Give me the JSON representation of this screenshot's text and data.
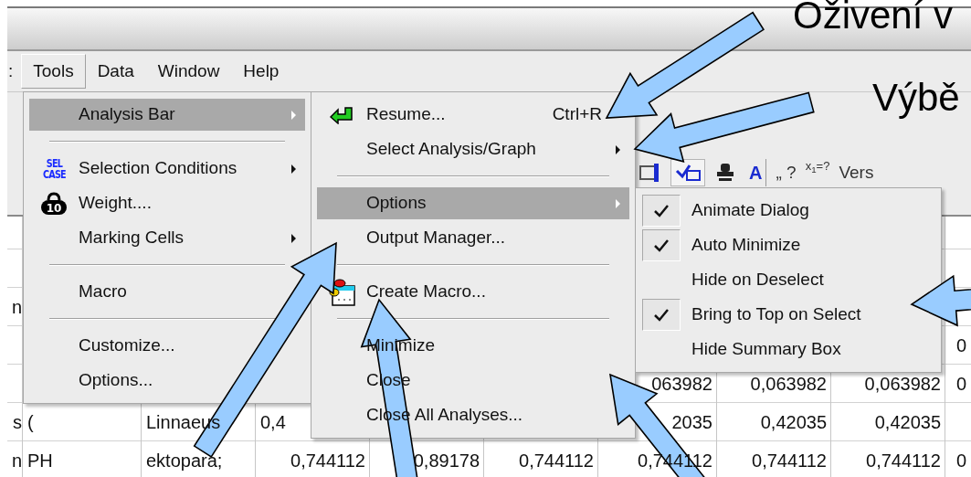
{
  "slide_captions": [
    "Oživení v",
    "Výbě"
  ],
  "menu_bar": [
    {
      "label": ":",
      "selected": false
    },
    {
      "label": "Tools",
      "selected": true
    },
    {
      "label": "Data",
      "selected": false
    },
    {
      "label": "Window",
      "selected": false
    },
    {
      "label": "Help",
      "selected": false
    }
  ],
  "toolbar": [
    {
      "kind": "frame-icon"
    },
    {
      "kind": "check-button"
    },
    {
      "kind": "stamp-icon"
    },
    {
      "kind": "font-button",
      "label": "A"
    },
    {
      "kind": "text",
      "label": "„ ?"
    },
    {
      "kind": "formula",
      "label": "x$_{1}$=?"
    },
    {
      "kind": "text",
      "label": "Vers"
    }
  ],
  "tools_menu": [
    {
      "kind": "item",
      "label": "Analysis Bar",
      "selected": true,
      "submenu": true
    },
    {
      "kind": "separator"
    },
    {
      "kind": "item",
      "label": "Selection Conditions",
      "selected": false,
      "submenu": true,
      "icon": {
        "kind": "sel-case",
        "lines": [
          "SEL",
          "CASE"
        ]
      }
    },
    {
      "kind": "item",
      "label": "Weight....",
      "selected": false,
      "submenu": false,
      "icon": {
        "kind": "weight",
        "text": "10"
      }
    },
    {
      "kind": "item",
      "label": "Marking Cells",
      "selected": false,
      "submenu": true
    },
    {
      "kind": "separator"
    },
    {
      "kind": "item",
      "label": "Macro",
      "selected": false,
      "submenu": false
    },
    {
      "kind": "separator"
    },
    {
      "kind": "item",
      "label": "Customize...",
      "selected": false,
      "submenu": false
    },
    {
      "kind": "item",
      "label": "Options...",
      "selected": false,
      "submenu": false
    }
  ],
  "analysis_bar_menu": [
    {
      "kind": "item",
      "label": "Resume...",
      "selected": false,
      "submenu": false,
      "shortcut": "Ctrl+R",
      "icon": {
        "kind": "resume"
      }
    },
    {
      "kind": "item",
      "label": "Select Analysis/Graph",
      "selected": false,
      "submenu": true
    },
    {
      "kind": "separator"
    },
    {
      "kind": "item",
      "label": "Options",
      "selected": true,
      "submenu": true
    },
    {
      "kind": "item",
      "label": "Output Manager...",
      "selected": false,
      "submenu": false
    },
    {
      "kind": "separator"
    },
    {
      "kind": "item",
      "label": "Create Macro...",
      "selected": false,
      "submenu": false,
      "icon": {
        "kind": "macro"
      }
    },
    {
      "kind": "separator"
    },
    {
      "kind": "item",
      "label": "Minimize",
      "selected": false,
      "submenu": false
    },
    {
      "kind": "item",
      "label": "Close",
      "selected": false,
      "submenu": false
    },
    {
      "kind": "item",
      "label": "Close All Analyses...",
      "selected": false,
      "submenu": false
    }
  ],
  "options_menu": [
    {
      "label": "Animate Dialog",
      "checked": true
    },
    {
      "label": "Auto Minimize",
      "checked": true
    },
    {
      "label": "Hide on Deselect",
      "checked": false
    },
    {
      "label": "Bring to Top on Select",
      "checked": true
    },
    {
      "label": "Hide Summary Box",
      "checked": false
    }
  ],
  "spreadsheet": {
    "rows": [
      {
        "cells": [
          null,
          null,
          null,
          null,
          null,
          null,
          null,
          null,
          null,
          null
        ]
      },
      {
        "cells": [
          null,
          null,
          null,
          null,
          null,
          null,
          null,
          null,
          null,
          null
        ]
      },
      {
        "cells": [
          {
            "text": "n"
          },
          null,
          null,
          null,
          null,
          null,
          null,
          null,
          null,
          null
        ]
      },
      {
        "cells": [
          null,
          null,
          null,
          null,
          null,
          null,
          null,
          null,
          null,
          {
            "text": "0"
          }
        ]
      },
      {
        "cells": [
          null,
          null,
          null,
          null,
          null,
          null,
          {
            "text": "063982"
          },
          {
            "text": "0,063982"
          },
          {
            "text": "0,063982"
          },
          {
            "text": "0"
          }
        ]
      },
      {
        "cells": [
          {
            "text": "s"
          },
          {
            "text": "("
          },
          {
            "text": "Linnaeus"
          },
          {
            "text": "0,4",
            "cut_end": true
          },
          null,
          null,
          {
            "text": "2035"
          },
          {
            "text": "0,42035"
          },
          {
            "text": "0,42035"
          },
          null
        ]
      },
      {
        "cells": [
          {
            "text": "n"
          },
          {
            "text": "PH"
          },
          {
            "text": "ektopara;"
          },
          {
            "text": "0,744112"
          },
          {
            "text": "0,89178"
          },
          {
            "text": "0,744112"
          },
          {
            "text": "0,744112"
          },
          {
            "text": "0,744112"
          },
          {
            "text": "0,744112"
          },
          {
            "text": "0"
          }
        ]
      }
    ]
  }
}
